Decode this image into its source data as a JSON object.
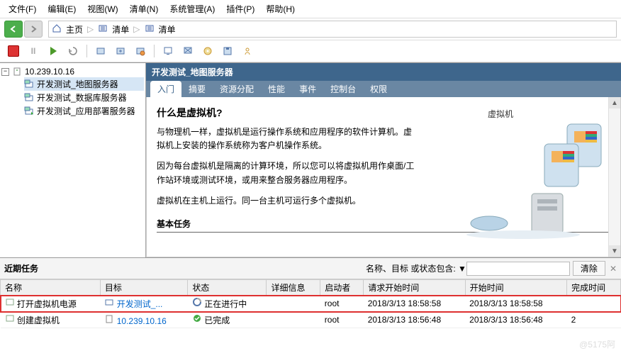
{
  "menu": {
    "file": "文件(F)",
    "edit": "编辑(E)",
    "view": "视图(W)",
    "inventory": "清单(N)",
    "admin": "系统管理(A)",
    "plugin": "插件(P)",
    "help": "帮助(H)"
  },
  "crumb": {
    "home": "主页",
    "inv1": "清单",
    "inv2": "清单"
  },
  "tree": {
    "root": "10.239.10.16",
    "vm1": "开发测试_地图服务器",
    "vm2": "开发测试_数据库服务器",
    "vm3": "开发测试_应用部署服务器"
  },
  "detail": {
    "title": "开发测试_地图服务器",
    "tabs": [
      "入门",
      "摘要",
      "资源分配",
      "性能",
      "事件",
      "控制台",
      "权限"
    ],
    "heading": "什么是虚拟机?",
    "para1": "与物理机一样，虚拟机是运行操作系统和应用程序的软件计算机。虚拟机上安装的操作系统称为客户机操作系统。",
    "para2": "因为每台虚拟机是隔离的计算环境，所以您可以将虚拟机用作桌面/工作站环境或测试环境，或用来整合服务器应用程序。",
    "para3": "虚拟机在主机上运行。同一台主机可运行多个虚拟机。",
    "illus_label": "虚拟机",
    "section": "基本任务"
  },
  "tasks": {
    "title": "近期任务",
    "filter_label": "名称、目标 或状态包含: ▼",
    "clear": "清除",
    "cols": {
      "name": "名称",
      "target": "目标",
      "status": "状态",
      "detail": "详细信息",
      "initiator": "启动者",
      "reqtime": "请求开始时间",
      "starttime": "开始时间",
      "endtime": "完成时间"
    },
    "rows": [
      {
        "name": "打开虚拟机电源",
        "target": "开发测试_...",
        "status": "正在进行中",
        "initiator": "root",
        "reqtime": "2018/3/13 18:58:58",
        "starttime": "2018/3/13 18:58:58",
        "endtime": ""
      },
      {
        "name": "创建虚拟机",
        "target": "10.239.10.16",
        "status": "已完成",
        "initiator": "root",
        "reqtime": "2018/3/13 18:56:48",
        "starttime": "2018/3/13 18:56:48",
        "endtime": "2"
      }
    ]
  },
  "watermark": "@5175阿"
}
